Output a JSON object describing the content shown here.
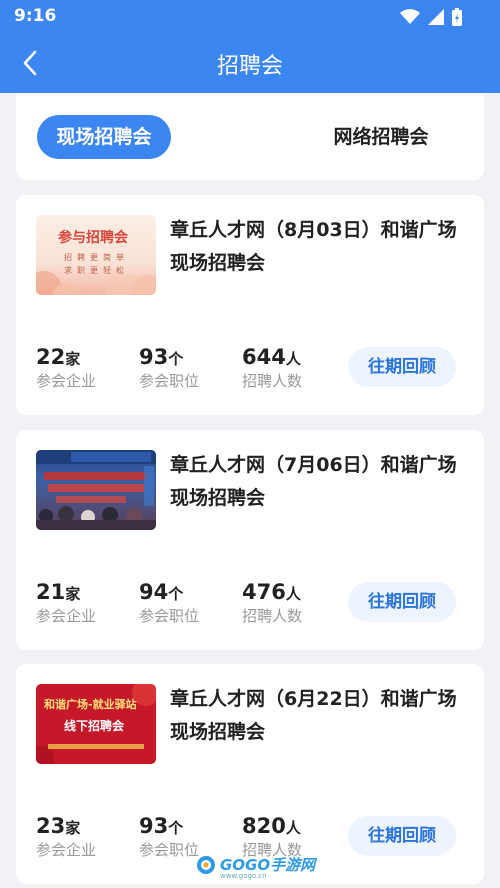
{
  "status_bar": {
    "time": "9:16"
  },
  "header": {
    "title": "招聘会"
  },
  "tabs": [
    {
      "label": "现场招聘会",
      "active": true
    },
    {
      "label": "网络招聘会",
      "active": false
    }
  ],
  "fairs": [
    {
      "title": "章丘人才网（8月03日）和谐广场现场招聘会",
      "thumb_text_main": "参与招聘会",
      "thumb_text_sub1": "招聘更简单",
      "thumb_text_sub2": "求职更轻松",
      "companies": "22",
      "companies_unit": "家",
      "companies_label": "参会企业",
      "positions": "93",
      "positions_unit": "个",
      "positions_label": "参会职位",
      "hires": "644",
      "hires_unit": "人",
      "hires_label": "招聘人数",
      "review_label": "往期回顾"
    },
    {
      "title": "章丘人才网（7月06日）和谐广场现场招聘会",
      "companies": "21",
      "companies_unit": "家",
      "companies_label": "参会企业",
      "positions": "94",
      "positions_unit": "个",
      "positions_label": "参会职位",
      "hires": "476",
      "hires_unit": "人",
      "hires_label": "招聘人数",
      "review_label": "往期回顾"
    },
    {
      "title": "章丘人才网（6月22日）和谐广场现场招聘会",
      "thumb_text_main": "和谐广场-就业驿站",
      "thumb_text_sub1": "线下招聘会",
      "companies": "23",
      "companies_unit": "家",
      "companies_label": "参会企业",
      "positions": "93",
      "positions_unit": "个",
      "positions_label": "参会职位",
      "hires": "820",
      "hires_unit": "人",
      "hires_label": "招聘人数",
      "review_label": "往期回顾"
    }
  ],
  "watermark": {
    "text": "GOGO手游网",
    "sub": "www.gogo.cn"
  },
  "colors": {
    "primary": "#3b86f0",
    "review_text": "#2b74dd",
    "background": "#f1f2f5"
  }
}
